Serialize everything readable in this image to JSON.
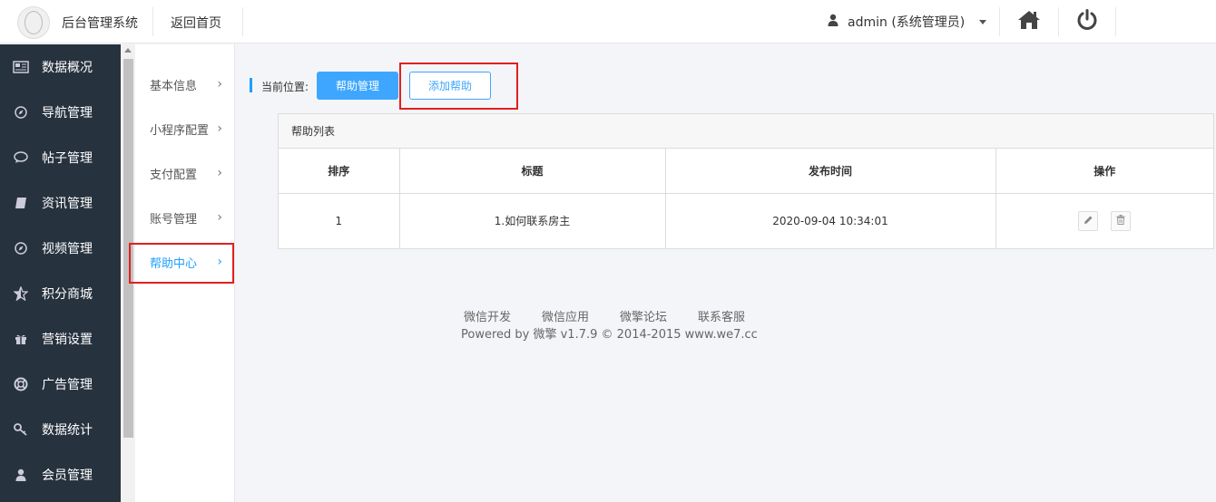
{
  "header": {
    "app_title": "后台管理系统",
    "home_link": "返回首页",
    "user": "admin (系统管理员)"
  },
  "sidebar": {
    "items": [
      {
        "label": "数据概况",
        "icon": "newspaper-icon"
      },
      {
        "label": "导航管理",
        "icon": "compass-icon"
      },
      {
        "label": "帖子管理",
        "icon": "comment-icon"
      },
      {
        "label": "资讯管理",
        "icon": "book-icon"
      },
      {
        "label": "视频管理",
        "icon": "compass-icon"
      },
      {
        "label": "积分商城",
        "icon": "star-half-icon"
      },
      {
        "label": "营销设置",
        "icon": "gift-icon"
      },
      {
        "label": "广告管理",
        "icon": "life-ring-icon"
      },
      {
        "label": "数据统计",
        "icon": "key-icon"
      },
      {
        "label": "会员管理",
        "icon": "user-icon"
      }
    ]
  },
  "submenu": {
    "items": [
      {
        "label": "基本信息",
        "arrow": "›"
      },
      {
        "label": "小程序配置",
        "arrow": "›"
      },
      {
        "label": "支付配置",
        "arrow": "›"
      },
      {
        "label": "账号管理",
        "arrow": "›"
      },
      {
        "label": "帮助中心",
        "arrow": "›",
        "active": true
      }
    ]
  },
  "breadcrumb": {
    "label": "当前位置:",
    "btn_manage": "帮助管理",
    "btn_add": "添加帮助"
  },
  "panel": {
    "title": "帮助列表",
    "columns": [
      "排序",
      "标题",
      "发布时间",
      "操作"
    ],
    "rows": [
      {
        "order": "1",
        "title": "1.如何联系房主",
        "time": "2020-09-04 10:34:01"
      }
    ]
  },
  "footer": {
    "links": [
      "微信开发",
      "微信应用",
      "微擎论坛",
      "联系客服"
    ],
    "powered": "Powered by 微擎 v1.7.9 © 2014-2015 www.we7.cc"
  },
  "colors": {
    "accent": "#3ea6ff",
    "sidebar_bg": "#27323f",
    "highlight": "#e02020"
  }
}
